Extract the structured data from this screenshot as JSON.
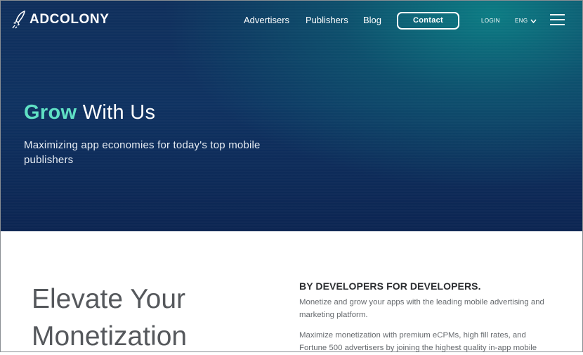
{
  "brand": {
    "logo_text": "ADCOLONY"
  },
  "nav": {
    "links": [
      "Advertisers",
      "Publishers",
      "Blog"
    ],
    "contact_label": "Contact",
    "login_label": "LOGIN",
    "language_label": "ENG",
    "icons": {
      "language": "chevron-down-icon",
      "menu": "hamburger-menu-icon",
      "logo": "rocket-logo-icon"
    }
  },
  "hero": {
    "title_accent": "Grow",
    "title_rest": "With Us",
    "subtitle": "Maximizing app economies for today's top mobile publishers",
    "accent_color": "#5ee0c4"
  },
  "section": {
    "heading": "Elevate Your Monetization",
    "dev_title": "BY DEVELOPERS FOR DEVELOPERS.",
    "paragraph1": "Monetize and grow your apps with the leading mobile advertising and marketing platform.",
    "paragraph2": "Maximize monetization with premium eCPMs, high fill rates, and Fortune 500 advertisers by joining the highest quality in-app mobile"
  }
}
